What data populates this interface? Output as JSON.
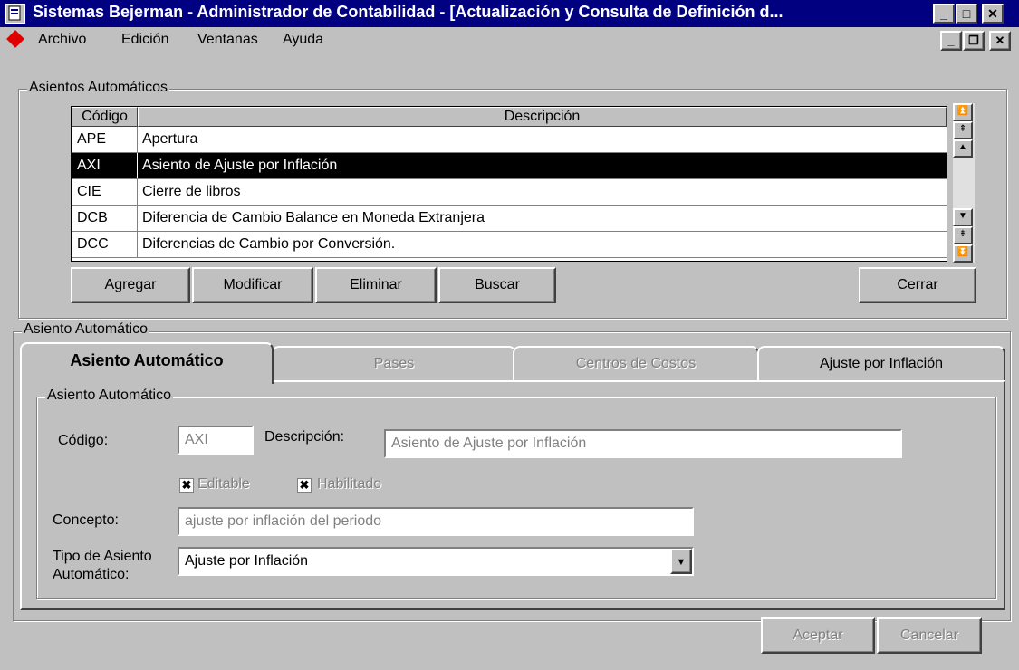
{
  "window": {
    "title": "Sistemas Bejerman - Administrador de Contabilidad - [Actualización y Consulta de Definición d..."
  },
  "menu": {
    "items": [
      "Archivo",
      "Edición",
      "Ventanas",
      "Ayuda"
    ]
  },
  "asientos": {
    "group_label": "Asientos Automáticos",
    "columns": [
      "Código",
      "Descripción"
    ],
    "rows": [
      {
        "codigo": "APE",
        "descripcion": "Apertura"
      },
      {
        "codigo": "AXI",
        "descripcion": "Asiento de Ajuste por Inflación"
      },
      {
        "codigo": "CIE",
        "descripcion": "Cierre de libros"
      },
      {
        "codigo": "DCB",
        "descripcion": "Diferencia de Cambio Balance en Moneda Extranjera"
      },
      {
        "codigo": "DCC",
        "descripcion": "Diferencias de Cambio por Conversión."
      }
    ],
    "selected_index": 1
  },
  "buttons": {
    "agregar": "Agregar",
    "modificar": "Modificar",
    "eliminar": "Eliminar",
    "buscar": "Buscar",
    "cerrar": "Cerrar",
    "aceptar": "Aceptar",
    "cancelar": "Cancelar"
  },
  "detail": {
    "group_label": "Asiento Automático",
    "tabs": [
      "Asiento Automático",
      "Pases",
      "Centros de Costos",
      "Ajuste por Inflación"
    ],
    "inner_group_label": "Asiento Automático",
    "codigo_label": "Código:",
    "codigo_value": "AXI",
    "descripcion_label": "Descripción:",
    "descripcion_value": "Asiento de Ajuste por Inflación",
    "editable_label": "Editable",
    "editable_checked": true,
    "habilitado_label": "Habilitado",
    "habilitado_checked": true,
    "concepto_label": "Concepto:",
    "concepto_value": "ajuste por inflación del periodo",
    "tipo_label_1": "Tipo de Asiento",
    "tipo_label_2": "Automático:",
    "tipo_value": "Ajuste por Inflación"
  },
  "colors": {
    "titlebar": "#000080",
    "face": "#c0c0c0",
    "selection": "#000000",
    "app_icon": "#e00000"
  }
}
